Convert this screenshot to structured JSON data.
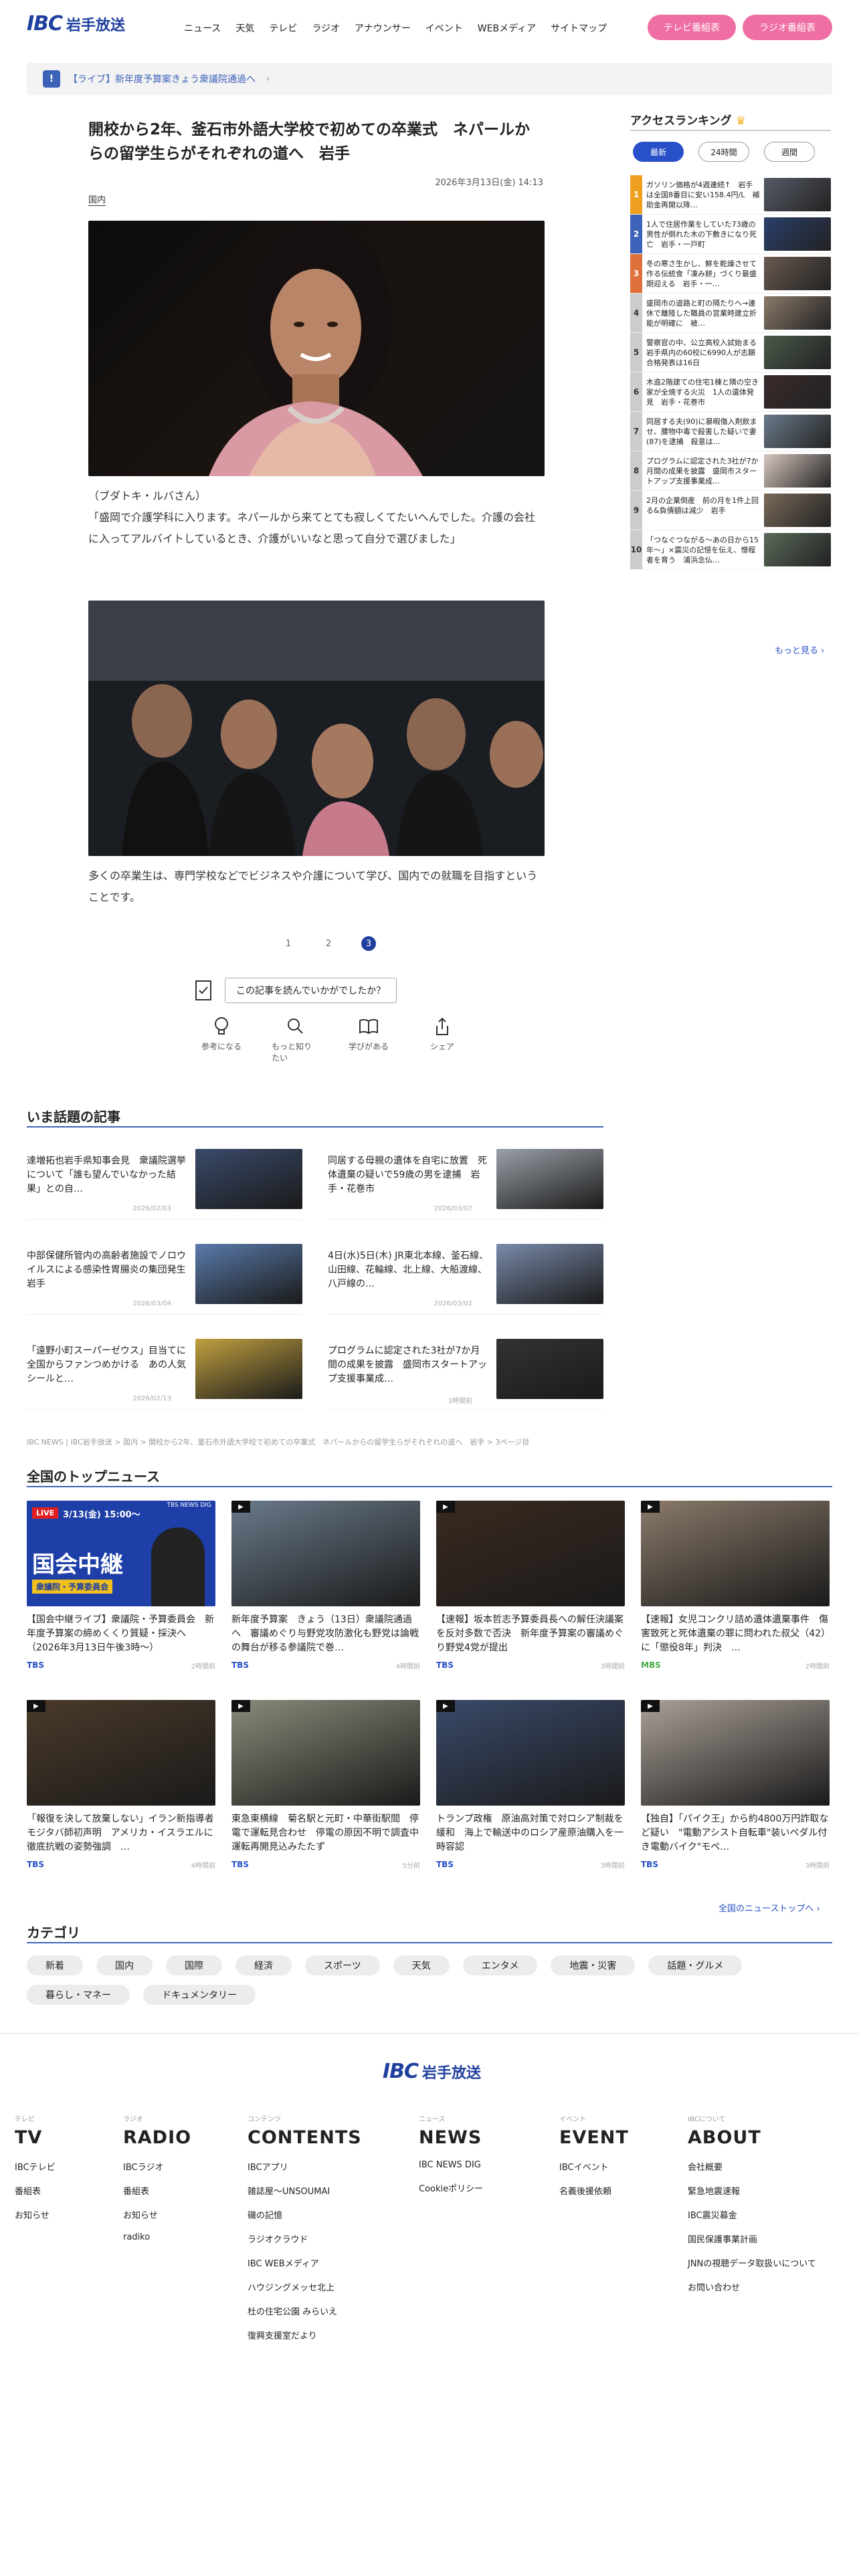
{
  "header": {
    "logo_mark": "IBC",
    "logo_text": "岩手放送",
    "nav": [
      "ニュース",
      "天気",
      "テレビ",
      "ラジオ",
      "アナウンサー",
      "イベント",
      "WEBメディア",
      "サイトマップ"
    ],
    "tv_button": "テレビ番組表",
    "radio_button": "ラジオ番組表"
  },
  "banner": {
    "icon": "!",
    "text": "【ライブ】新年度予算案きょう衆議院通過へ",
    "chevron": "›"
  },
  "article": {
    "title": "開校から2年、釜石市外語大学校で初めての卒業式　ネパールからの留学生らがそれぞれの道へ　岩手",
    "date": "2026年3月13日(金) 14:13",
    "tag": "国内",
    "caption1": "（ブダトキ・ルバさん）\n「盛岡で介護学科に入ります。ネパールから来てとても寂しくてたいへんでした。介護の会社に入ってアルバイトしているとき、介護がいいなと思って自分で選びました」",
    "caption2": "多くの卒業生は、専門学校などでビジネスや介護について学び、国内での就職を目指すということです。",
    "pages": [
      "1",
      "2",
      "3"
    ],
    "question": "この記事を読んでいかがでしたか？",
    "reactions": [
      {
        "icon": "lightbulb-icon",
        "label": "参考になる"
      },
      {
        "icon": "search-icon",
        "label": "もっと知りたい"
      },
      {
        "icon": "book-icon",
        "label": "学びがある"
      },
      {
        "icon": "share-icon",
        "label": "シェア"
      }
    ]
  },
  "ranking": {
    "title": "アクセスランキング",
    "tabs": [
      "最新",
      "24時間",
      "週間"
    ],
    "items": [
      {
        "n": "1",
        "color": "#f0a020",
        "text": "ガソリン価格が4週連続↑　岩手は全国8番目に安い158.4円/L　補助金再開以降…"
      },
      {
        "n": "2",
        "color": "#3d63b8",
        "text": "1人で住居作業をしていた73歳の男性が倒れた木の下敷きになり死亡　岩手・一戸町"
      },
      {
        "n": "3",
        "color": "#e0703a",
        "text": "冬の寒さ生かし、鮮を乾燥させて作る伝統食「凍み餅」づくり最盛期迎える　岩手・一…"
      },
      {
        "n": "4",
        "color": "#ccc",
        "text": "盛岡市の道路と町の隔たりへ→連休で離陸した職員の営業時建立折能が明確に　被…"
      },
      {
        "n": "5",
        "color": "#ccc",
        "text": "警察官の中、公立高校入試始まる　岩手県内の60校に6990人が志願　合格発表は16日"
      },
      {
        "n": "6",
        "color": "#ccc",
        "text": "木造2階建ての住宅1棟と隣の空き家が全焼する火災　1人の遺体発見　岩手・花巻市"
      },
      {
        "n": "7",
        "color": "#ccc",
        "text": "同居する夫(90)に暴暇傷入剤飲ませ、腰物中毒で殺害した疑いで妻(87)を逮捕　殺意は…"
      },
      {
        "n": "8",
        "color": "#ccc",
        "text": "プログラムに認定された3社が7か月間の成果を披露　盛岡市スタートアップ支援事業成…"
      },
      {
        "n": "9",
        "color": "#ccc",
        "text": "2月の企業倒産　前の月を1件上回る&負債額は減少　岩手"
      },
      {
        "n": "10",
        "color": "#ccc",
        "text": "「つなぐつながる〜あの日から15年〜」×震災の記憶を伝え、憎程者を育う　浦浜念仏…"
      }
    ],
    "more": "もっと見る"
  },
  "topics": {
    "title": "いま話題の記事",
    "items": [
      {
        "t": "達増拓也岩手県知事会見　衆議院選挙について「誰も望んでいなかった結果」との自…",
        "d": "2026/02/03"
      },
      {
        "t": "同居する母親の遺体を自宅に放置　死体遺棄の疑いで59歳の男を逮捕　岩手・花巻市",
        "d": "2026/03/07"
      },
      {
        "t": "中部保健所管内の高齢者施設でノロウイルスによる感染性胃腸炎の集団発生　岩手",
        "d": "2026/03/04"
      },
      {
        "t": "4日(水)5日(木) JR東北本線、釜石線、山田線、花輪線、北上線、大船渡線、八戸線の…",
        "d": "2026/03/02"
      },
      {
        "t": "「遠野小町スーパーゼウス」目当てに全国からファンつめかける　あの人気シールと…",
        "d": "2026/02/13"
      },
      {
        "t": "プログラムに認定された3社が7か月間の成果を披露　盛岡市スタートアップ支援事業成…",
        "d": "3時間前"
      }
    ]
  },
  "breadcrumb": "IBC NEWS | IBC岩手放送 > 国内 > 開校から2年、釜石市外語大学校で初めての卒業式　ネパールからの留学生らがそれぞれの道へ　岩手 > 3ページ目",
  "national": {
    "title": "全国のトップニュース",
    "items": [
      {
        "t": "【国会中継ライブ】衆議院・予算委員会　新年度予算案の締めくくり質疑・採決へ（2026年3月13日午後3時〜）",
        "src": "TBS",
        "tm": "2時間前",
        "srcColor": "#2850c8"
      },
      {
        "t": "新年度予算案　きょう（13日）衆議院通過へ　審議めぐり与野党攻防激化も野党は論戦の舞台が移る参議院で巻…",
        "src": "TBS",
        "tm": "4時間前",
        "srcColor": "#2850c8"
      },
      {
        "t": "【速報】坂本哲志予算委員長への解任決議案を反対多数で否決　新年度予算案の審議めぐり野党4党が提出",
        "src": "TBS",
        "tm": "3時間前",
        "srcColor": "#2850c8"
      },
      {
        "t": "【速報】女児コンクリ詰め遺体遺棄事件　傷害致死と死体遺棄の罪に問われた叔父（42）に「懲役8年」判決　…",
        "src": "MBS",
        "tm": "2時間前",
        "srcColor": "#44aa44"
      },
      {
        "t": "「報復を決して放棄しない」イラン新指導者モジタバ師初声明　アメリカ・イスラエルに徹底抗戦の姿勢強調　…",
        "src": "TBS",
        "tm": "4時間前",
        "srcColor": "#2850c8"
      },
      {
        "t": "東急東横線　菊名駅と元町・中華街駅間　停電で運転見合わせ　停電の原因不明で調査中　運転再開見込みたたず",
        "src": "TBS",
        "tm": "5分前",
        "srcColor": "#2850c8"
      },
      {
        "t": "トランプ政権　原油高対策で対ロシア制裁を緩和　海上で輸送中のロシア産原油購入を一時容認",
        "src": "TBS",
        "tm": "3時間前",
        "srcColor": "#2850c8"
      },
      {
        "t": "【独自】「パイク王」から約4800万円詐取など疑い　\"電動アシスト自転車\"装いペダル付き電動バイク\"モペ…",
        "src": "TBS",
        "tm": "3時間前",
        "srcColor": "#2850c8"
      }
    ],
    "live_tag": "LIVE",
    "live_time": "3/13(金) 15:00〜",
    "live_title": "国会中継",
    "live_sub": "衆議院・予算委員会",
    "tbs_tag": "TBS NEWS DIG",
    "more": "全国のニューストップへ"
  },
  "categories": {
    "title": "カテゴリ",
    "items": [
      "新着",
      "国内",
      "国際",
      "経済",
      "スポーツ",
      "天気",
      "エンタメ",
      "地震・災害",
      "話題・グルメ",
      "暮らし・マネー",
      "ドキュメンタリー"
    ]
  },
  "footer": {
    "cols": [
      {
        "k": "テレビ",
        "h": "TV",
        "links": [
          "IBCテレビ",
          "番組表",
          "お知らせ"
        ]
      },
      {
        "k": "ラジオ",
        "h": "RADIO",
        "links": [
          "IBCラジオ",
          "番組表",
          "お知らせ",
          "radiko"
        ]
      },
      {
        "k": "コンテンツ",
        "h": "CONTENTS",
        "links": [
          "IBCアプリ",
          "雑誌屋〜UNSOUMAI",
          "磯の記憶",
          "ラジオクラウド",
          "IBC WEBメディア",
          "ハウジングメッセ北上",
          "杜の住宅公園 みらいえ",
          "復興支援室だより"
        ]
      },
      {
        "k": "ニュース",
        "h": "NEWS",
        "links": [
          "IBC NEWS DIG",
          "Cookieポリシー"
        ]
      },
      {
        "k": "イベント",
        "h": "EVENT",
        "links": [
          "IBCイベント",
          "名義後援依頼"
        ]
      },
      {
        "k": "IBCについて",
        "h": "ABOUT",
        "links": [
          "会社概要",
          "緊急地震速報",
          "IBC震災募金",
          "国民保護事業計画",
          "JNNの視聴データ取扱いについて",
          "お問い合わせ"
        ]
      }
    ]
  },
  "colors": {
    "brand": "#1f3f9f",
    "pink": "#ef6ea3",
    "accent": "#2850c8"
  }
}
